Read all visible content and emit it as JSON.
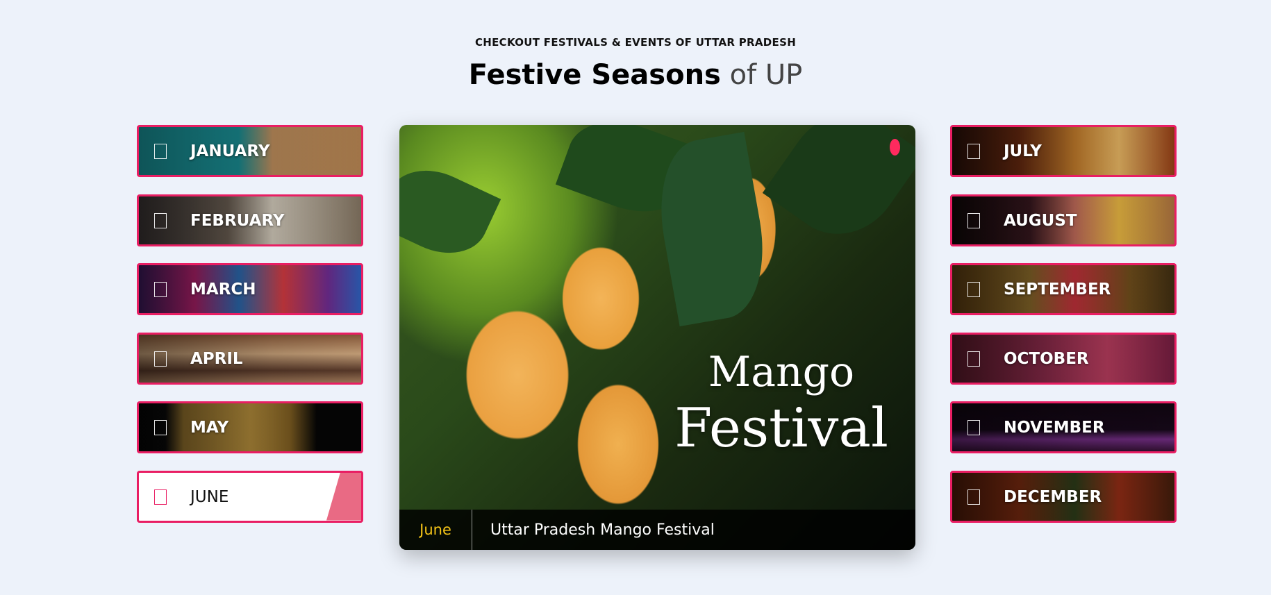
{
  "header": {
    "eyebrow": "CHECKOUT FESTIVALS & EVENTS OF UTTAR PRADESH",
    "title_bold": "Festive Seasons",
    "title_light": "of UP"
  },
  "months_left": [
    {
      "label": "JANUARY"
    },
    {
      "label": "FEBRUARY"
    },
    {
      "label": "MARCH"
    },
    {
      "label": "APRIL"
    },
    {
      "label": "MAY"
    },
    {
      "label": "JUNE",
      "active": true
    }
  ],
  "months_right": [
    {
      "label": "JULY"
    },
    {
      "label": "AUGUST"
    },
    {
      "label": "SEPTEMBER"
    },
    {
      "label": "OCTOBER"
    },
    {
      "label": "NOVEMBER"
    },
    {
      "label": "DECEMBER"
    }
  ],
  "feature": {
    "image_text_line1": "Mango",
    "image_text_line2": "Festival",
    "caption_month": "June",
    "caption_title": "Uttar Pradesh Mango Festival"
  },
  "colors": {
    "accent": "#e91e63",
    "background": "#edf2fa",
    "caption_month": "#f5c518"
  }
}
